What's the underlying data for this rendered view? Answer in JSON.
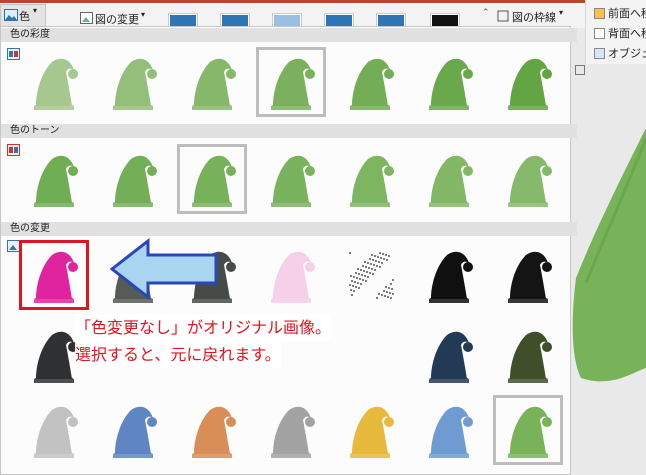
{
  "ribbon": {
    "color_label": "色",
    "change_picture_label": "図の変更",
    "border_label": "図の枠線",
    "bring_forward_label": "前面へ移",
    "send_backward_label": "背面へ移",
    "object_label": "オブジェク"
  },
  "sections": [
    {
      "title": "色の彩度",
      "selected_index": 3,
      "colors": [
        "#a6c78d",
        "#94bf7a",
        "#86b76a",
        "#7bb15e",
        "#73ad55",
        "#6aa84c",
        "#63a544"
      ]
    },
    {
      "title": "色のトーン",
      "selected_index": 2,
      "colors": [
        "#6fae54",
        "#72af56",
        "#77b15a",
        "#7ab35d",
        "#7eb561",
        "#82b765",
        "#86b96a"
      ]
    },
    {
      "title": "色の変更",
      "selected_index": 0,
      "rows": [
        [
          "#e0239e",
          "#555b57",
          "#474b47",
          "#f6cfe8",
          "dots",
          "#101010",
          "#141414"
        ],
        [
          "#2e3032",
          "",
          "",
          "",
          "",
          "#233a56",
          "#3f4f2a"
        ],
        [
          "#c2c2c2",
          "#5f85c2",
          "#d98d57",
          "#a3a3a3",
          "#e7b93c",
          "#6f9bd0",
          "#78b35a"
        ]
      ],
      "row3_selected": 6
    }
  ],
  "annotation": {
    "line1": "「色変更なし」がオリジナル画像。",
    "line2": "選択すると、元に戻れます。"
  },
  "colors": {
    "accent_red": "#e0141e",
    "arrow_fill": "#a9d5f0",
    "arrow_stroke": "#2a46b8"
  }
}
